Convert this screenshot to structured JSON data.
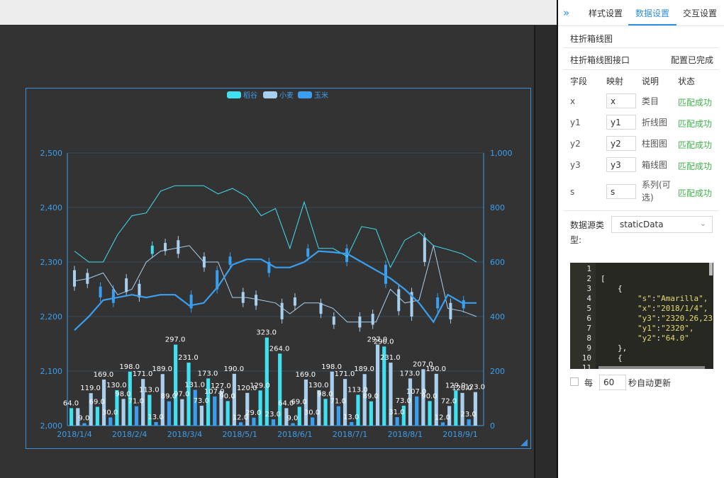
{
  "panel": {
    "tabs": [
      {
        "label": "样式设置"
      },
      {
        "label": "数据设置"
      },
      {
        "label": "交互设置"
      }
    ],
    "active_tab": "数据设置",
    "component_name": "柱折箱线图",
    "interface_name": "柱折箱线图接口",
    "config_status": "配置已完成",
    "columns": {
      "field": "字段",
      "mapping": "映射",
      "desc": "说明",
      "status": "状态"
    },
    "fields": [
      {
        "field": "x",
        "mapping": "x",
        "desc": "类目",
        "status": "匹配成功"
      },
      {
        "field": "y1",
        "mapping": "y1",
        "desc": "折线图",
        "status": "匹配成功"
      },
      {
        "field": "y2",
        "mapping": "y2",
        "desc": "柱图图",
        "status": "匹配成功"
      },
      {
        "field": "y3",
        "mapping": "y3",
        "desc": "箱线图",
        "status": "匹配成功"
      },
      {
        "field": "s",
        "mapping": "s",
        "desc": "系列(可选)",
        "status": "匹配成功"
      }
    ],
    "source_type_label": "数据源类型:",
    "source_type_value": "staticData",
    "code_lines": [
      "1",
      "2",
      "3",
      "4",
      "5",
      "6",
      "7",
      "8",
      "9",
      "10",
      "11"
    ],
    "code": {
      "l2": "[",
      "l3": "{",
      "l4_key": "\"s\"",
      "l4_val": "\"Amarilla\",",
      "l5_key": "\"x\"",
      "l5_val": "\"2018/1/4\",",
      "l6_key": "\"y3\"",
      "l6_val": "\"2320.26,23",
      "l7_key": "\"y1\"",
      "l7_val": "\"2320\",",
      "l8_key": "\"y2\"",
      "l8_val": "\"64.0\"",
      "l9": "},",
      "l10": "{"
    },
    "auto_update_prefix": "每",
    "auto_update_seconds": "60",
    "auto_update_suffix": "秒自动更新"
  },
  "colors": {
    "accent": "#2f8ee0",
    "success": "#3fb24a",
    "series_daogu": "#40e0f0",
    "series_xiaomai": "#a8cfee",
    "series_yumi": "#3a9ff0"
  },
  "chart_data": {
    "type": "bar",
    "legend": [
      "稻谷",
      "小麦",
      "玉米"
    ],
    "legend_placement": "top-center",
    "x_ticks": [
      "2018/1/4",
      "2018/2/4",
      "2018/3/4",
      "2018/5/1",
      "2018/6/1",
      "2018/7/1",
      "2018/8/1",
      "2018/9/1"
    ],
    "y_left_ticks": [
      "2,000",
      "2,100",
      "2,200",
      "2,300",
      "2,400",
      "2,500"
    ],
    "y_right_ticks": [
      "0",
      "200",
      "400",
      "600",
      "800",
      "1,000"
    ],
    "ylim_left": [
      2000,
      2500
    ],
    "ylim_right": [
      0,
      1000
    ],
    "grid": true,
    "bars": [
      {
        "s": 0,
        "v": 64,
        "label": "64.0"
      },
      {
        "s": 1,
        "v": 64
      },
      {
        "s": 2,
        "v": 9,
        "label": "9.0"
      },
      {
        "s": 1,
        "v": 119,
        "label": "119.0"
      },
      {
        "s": 0,
        "v": 69,
        "label": "69.0"
      },
      {
        "s": 1,
        "v": 169,
        "label": "169.0"
      },
      {
        "s": 2,
        "v": 30,
        "label": "30.0"
      },
      {
        "s": 0,
        "v": 130,
        "label": "130.0"
      },
      {
        "s": 1,
        "v": 98,
        "label": "98.0"
      },
      {
        "s": 0,
        "v": 198,
        "label": "198.0"
      },
      {
        "s": 2,
        "v": 71,
        "label": "71.0"
      },
      {
        "s": 1,
        "v": 171,
        "label": "171.0"
      },
      {
        "s": 0,
        "v": 113,
        "label": "113.0"
      },
      {
        "s": 2,
        "v": 13,
        "label": "13.0"
      },
      {
        "s": 1,
        "v": 189,
        "label": "189.0"
      },
      {
        "s": 2,
        "v": 89,
        "label": "89.0"
      },
      {
        "s": 0,
        "v": 297,
        "label": "297.0"
      },
      {
        "s": 1,
        "v": 97,
        "label": "97.0"
      },
      {
        "s": 0,
        "v": 231,
        "label": "231.0"
      },
      {
        "s": 2,
        "v": 131,
        "label": "131.0"
      },
      {
        "s": 1,
        "v": 73,
        "label": "73.0"
      },
      {
        "s": 0,
        "v": 173,
        "label": "173.0"
      },
      {
        "s": 2,
        "v": 107,
        "label": "107.0"
      },
      {
        "s": 1,
        "v": 127,
        "label": "127.0"
      },
      {
        "s": 0,
        "v": 90,
        "label": "90.0"
      },
      {
        "s": 1,
        "v": 190,
        "label": "190.0"
      },
      {
        "s": 2,
        "v": 12,
        "label": "12.0"
      },
      {
        "s": 1,
        "v": 120,
        "label": "120.0"
      },
      {
        "s": 2,
        "v": 29,
        "label": "29.0"
      },
      {
        "s": 0,
        "v": 129,
        "label": "129.0"
      },
      {
        "s": 0,
        "v": 323,
        "label": "323.0"
      },
      {
        "s": 2,
        "v": 23,
        "label": "23.0"
      },
      {
        "s": 0,
        "v": 264,
        "label": "264.0"
      },
      {
        "s": 1,
        "v": 64,
        "label": "64.0"
      },
      {
        "s": 2,
        "v": 9,
        "label": "9.0"
      },
      {
        "s": 0,
        "v": 69,
        "label": "69.0"
      },
      {
        "s": 1,
        "v": 169,
        "label": "169.0"
      },
      {
        "s": 2,
        "v": 30,
        "label": "30.0"
      },
      {
        "s": 1,
        "v": 130,
        "label": "130.0"
      },
      {
        "s": 0,
        "v": 98,
        "label": "98.0"
      },
      {
        "s": 1,
        "v": 198,
        "label": "198.0"
      },
      {
        "s": 2,
        "v": 71,
        "label": "71.0"
      },
      {
        "s": 1,
        "v": 171,
        "label": "171.0"
      },
      {
        "s": 2,
        "v": 13,
        "label": "13.0"
      },
      {
        "s": 0,
        "v": 113,
        "label": "113.0"
      },
      {
        "s": 1,
        "v": 189,
        "label": "189.0"
      },
      {
        "s": 0,
        "v": 89,
        "label": "89.0"
      },
      {
        "s": 1,
        "v": 297,
        "label": "297.0"
      },
      {
        "s": 0,
        "v": 290,
        "label": "290.0"
      },
      {
        "s": 1,
        "v": 231,
        "label": "231.0"
      },
      {
        "s": 2,
        "v": 31,
        "label": "31.0"
      },
      {
        "s": 0,
        "v": 73,
        "label": "73.0"
      },
      {
        "s": 1,
        "v": 173,
        "label": "173.0"
      },
      {
        "s": 2,
        "v": 107,
        "label": "107.0"
      },
      {
        "s": 1,
        "v": 207,
        "label": "207.0"
      },
      {
        "s": 0,
        "v": 90,
        "label": "90.0"
      },
      {
        "s": 1,
        "v": 190,
        "label": "190.0"
      },
      {
        "s": 2,
        "v": 12,
        "label": "12.0"
      },
      {
        "s": 1,
        "v": 72,
        "label": "72.0"
      },
      {
        "s": 0,
        "v": 129,
        "label": "129.0"
      },
      {
        "s": 1,
        "v": 120,
        "label": "120.0"
      },
      {
        "s": 2,
        "v": 23,
        "label": "23.0"
      },
      {
        "s": 1,
        "v": 123,
        "label": "123.0"
      }
    ],
    "lines": [
      {
        "series": 0,
        "points": [
          2320,
          2300,
          2300,
          2350,
          2385,
          2390,
          2430,
          2440,
          2440,
          2440,
          2425,
          2435,
          2420,
          2385,
          2398,
          2325,
          2410,
          2325,
          2325,
          2310,
          2365,
          2360,
          2290,
          2340,
          2355,
          2330,
          2323,
          2315,
          2300
        ]
      },
      {
        "series": 1,
        "points": [
          2265,
          2270,
          2280,
          2240,
          2250,
          2300,
          2320,
          2325,
          2330,
          2300,
          2300,
          2235,
          2235,
          2230,
          2225,
          2205,
          2225,
          2225,
          2215,
          2190,
          2190,
          2190,
          2250,
          2225,
          2230,
          2330,
          2215,
          2210,
          2200
        ]
      },
      {
        "series": 2,
        "points": [
          2175,
          2200,
          2230,
          2235,
          2240,
          2235,
          2240,
          2240,
          2220,
          2225,
          2255,
          2295,
          2305,
          2305,
          2290,
          2290,
          2300,
          2320,
          2318,
          2315,
          2300,
          2285,
          2270,
          2250,
          2225,
          2190,
          2240,
          2225,
          2225
        ]
      }
    ],
    "boxes": [
      {
        "s": 1,
        "low": 2255,
        "high": 2285
      },
      {
        "s": 1,
        "low": 2260,
        "high": 2280
      },
      {
        "s": 2,
        "low": 2235,
        "high": 2255
      },
      {
        "s": 2,
        "low": 2225,
        "high": 2250
      },
      {
        "s": 1,
        "low": 2245,
        "high": 2270
      },
      {
        "s": 1,
        "low": 2235,
        "high": 2260
      },
      {
        "s": 0,
        "low": 2315,
        "high": 2330
      },
      {
        "s": 1,
        "low": 2320,
        "high": 2335
      },
      {
        "s": 1,
        "low": 2315,
        "high": 2340
      },
      {
        "s": 2,
        "low": 2215,
        "high": 2240
      },
      {
        "s": 1,
        "low": 2290,
        "high": 2310
      },
      {
        "s": 2,
        "low": 2250,
        "high": 2285
      },
      {
        "s": 2,
        "low": 2295,
        "high": 2310
      },
      {
        "s": 1,
        "low": 2225,
        "high": 2245
      },
      {
        "s": 1,
        "low": 2220,
        "high": 2240
      },
      {
        "s": 2,
        "low": 2280,
        "high": 2300
      },
      {
        "s": 1,
        "low": 2195,
        "high": 2225
      },
      {
        "s": 1,
        "low": 2220,
        "high": 2235
      },
      {
        "s": 2,
        "low": 2310,
        "high": 2325
      },
      {
        "s": 1,
        "low": 2205,
        "high": 2225
      },
      {
        "s": 1,
        "low": 2185,
        "high": 2200
      },
      {
        "s": 2,
        "low": 2300,
        "high": 2325
      },
      {
        "s": 1,
        "low": 2180,
        "high": 2200
      },
      {
        "s": 1,
        "low": 2185,
        "high": 2205
      },
      {
        "s": 2,
        "low": 2260,
        "high": 2295
      },
      {
        "s": 1,
        "low": 2210,
        "high": 2250
      },
      {
        "s": 1,
        "low": 2200,
        "high": 2245
      },
      {
        "s": 1,
        "low": 2300,
        "high": 2345
      },
      {
        "s": 2,
        "low": 2215,
        "high": 2235
      },
      {
        "s": 1,
        "low": 2195,
        "high": 2225
      },
      {
        "s": 2,
        "low": 2215,
        "high": 2230
      }
    ]
  }
}
